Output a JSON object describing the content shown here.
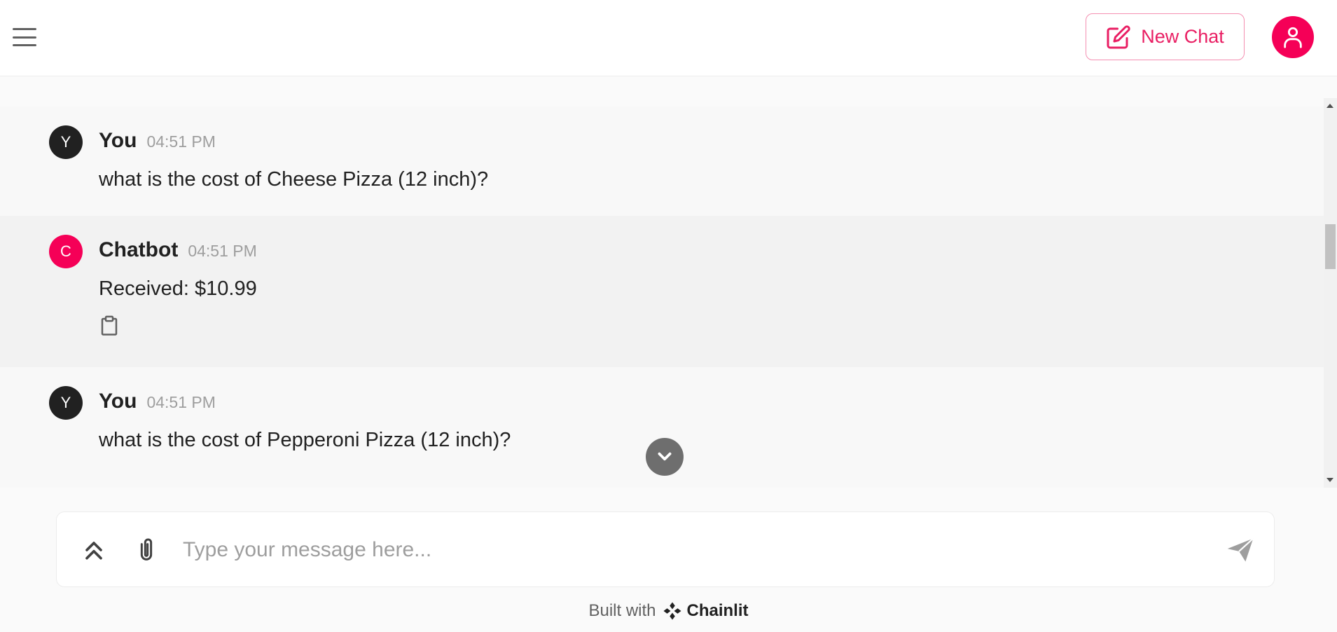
{
  "header": {
    "new_chat_label": "New Chat",
    "accent_color": "#e91e63"
  },
  "messages": [
    {
      "author": "You",
      "avatar_letter": "Y",
      "time": "04:51 PM",
      "text": "what is the cost of Cheese Pizza (12 inch)?"
    },
    {
      "author": "Chatbot",
      "avatar_letter": "C",
      "time": "04:51 PM",
      "text": "Received: $10.99"
    },
    {
      "author": "You",
      "avatar_letter": "Y",
      "time": "04:51 PM",
      "text": "what is the cost of Pepperoni Pizza (12 inch)?"
    }
  ],
  "composer": {
    "placeholder": "Type your message here..."
  },
  "footer": {
    "built_with": "Built with",
    "brand": "Chainlit"
  },
  "icons": {
    "menu": "hamburger-menu-icon",
    "new_chat": "edit-icon",
    "user": "user-icon",
    "copy": "clipboard-icon",
    "scroll_down": "chevron-down-icon",
    "settings": "chevrons-up-icon",
    "attach": "paperclip-icon",
    "send": "send-icon"
  }
}
